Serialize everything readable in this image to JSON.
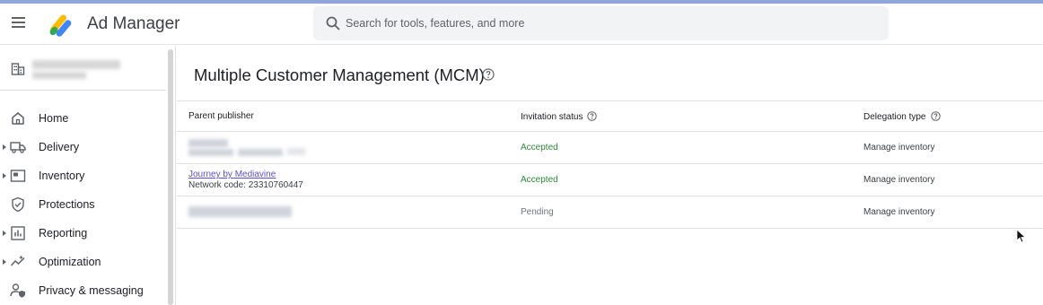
{
  "header": {
    "menu_icon": "menu-icon",
    "app_title": "Ad Manager",
    "search_placeholder": "Search for tools, features, and more"
  },
  "sidebar": {
    "account_icon": "building-icon",
    "nav": [
      {
        "label": "Home",
        "icon": "home-icon",
        "expandable": false
      },
      {
        "label": "Delivery",
        "icon": "truck-icon",
        "expandable": true
      },
      {
        "label": "Inventory",
        "icon": "inventory-icon",
        "expandable": true
      },
      {
        "label": "Protections",
        "icon": "shield-icon",
        "expandable": false
      },
      {
        "label": "Reporting",
        "icon": "reporting-icon",
        "expandable": true
      },
      {
        "label": "Optimization",
        "icon": "optimization-icon",
        "expandable": true
      },
      {
        "label": "Privacy & messaging",
        "icon": "privacy-icon",
        "expandable": false
      }
    ]
  },
  "main": {
    "title": "Multiple Customer Management (MCM)",
    "table": {
      "headers": [
        "Parent publisher",
        "Invitation status",
        "Delegation type"
      ],
      "rows": [
        {
          "publisher": "",
          "network_code": "",
          "status": "Accepted",
          "delegation": "Manage inventory"
        },
        {
          "publisher": "Journey by Mediavine",
          "network_code": "Network code: 23310760447",
          "status": "Accepted",
          "delegation": "Manage inventory"
        },
        {
          "publisher": "",
          "network_code": "",
          "status": "Pending",
          "delegation": "Manage inventory"
        }
      ]
    }
  },
  "colors": {
    "accepted": "#2e8b3c",
    "pending": "#70757a",
    "link": "#5b4fcf",
    "top_accent": "#8fa6d8"
  }
}
